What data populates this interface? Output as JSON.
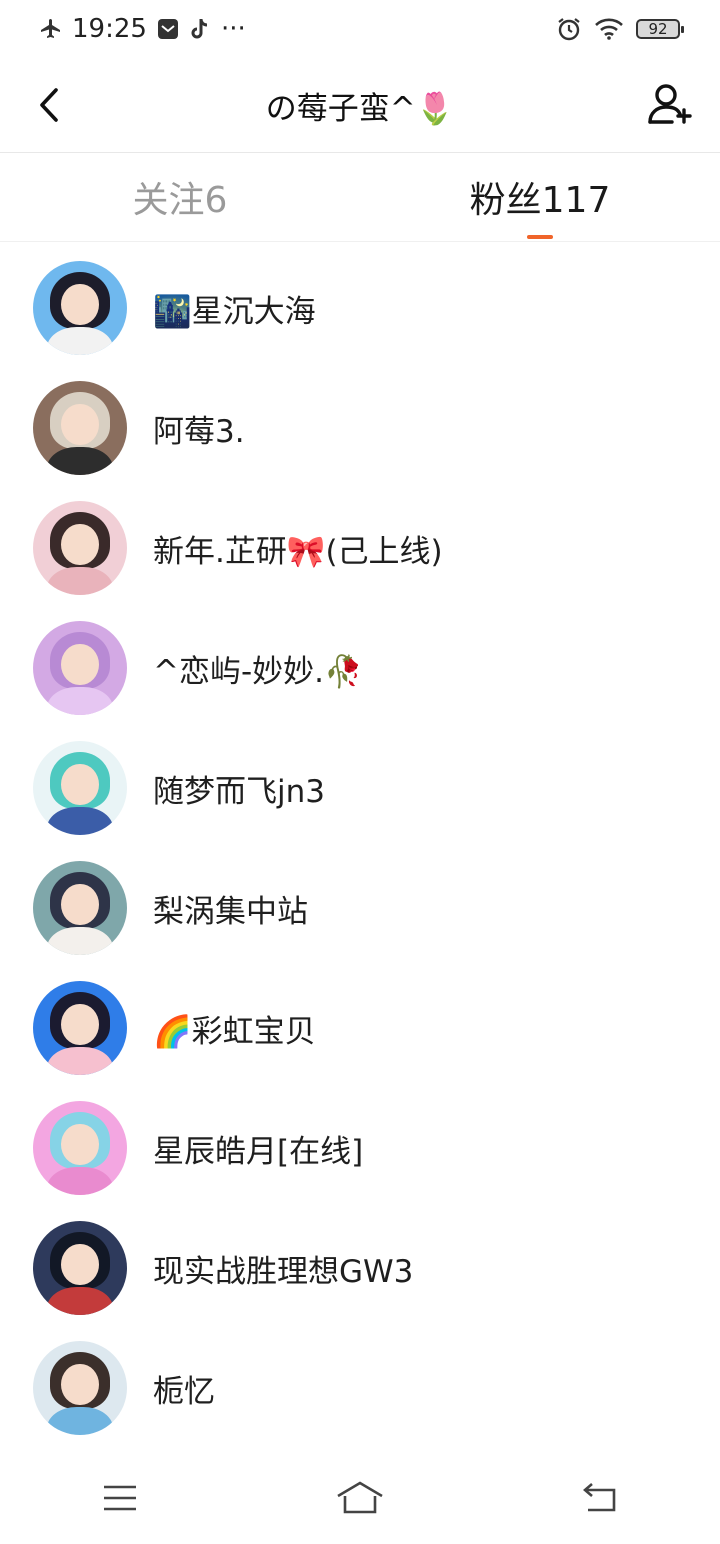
{
  "status_bar": {
    "time": "19:25",
    "more": "···",
    "battery": "92",
    "icons": [
      "airplane-icon",
      "mail-icon",
      "tiktok-icon",
      "alarm-icon",
      "wifi-icon",
      "battery-icon"
    ]
  },
  "header": {
    "title": "の莓子蛮^🌷"
  },
  "tabs": [
    {
      "label": "关注6",
      "active": false
    },
    {
      "label": "粉丝117",
      "active": true
    }
  ],
  "colors": {
    "accent": "#f0642a",
    "inactive_tab": "#9a9a9a"
  },
  "followers": [
    {
      "name": "🌃星沉大海",
      "avatar_bg": "#6fb8ee",
      "hair": "#1d1d2b",
      "body": "#f2f2f2"
    },
    {
      "name": "阿莓3.",
      "avatar_bg": "#8a6e5e",
      "hair": "#d8cfc2",
      "body": "#2d2d2d"
    },
    {
      "name": "新年.芷研🎀(己上线)",
      "avatar_bg": "#f1cfd6",
      "hair": "#3a2a2a",
      "body": "#e9b3bb"
    },
    {
      "name": "^恋屿-妙妙.🥀",
      "avatar_bg": "#d3a9e4",
      "hair": "#b88ad4",
      "body": "#e6c6f2"
    },
    {
      "name": "随梦而飞jn3",
      "avatar_bg": "#e9f4f6",
      "hair": "#4ec9c0",
      "body": "#3b5da8"
    },
    {
      "name": "梨涡集中站",
      "avatar_bg": "#7fa7aa",
      "hair": "#2e3448",
      "body": "#f3f0ec"
    },
    {
      "name": "🌈彩虹宝贝",
      "avatar_bg": "#2f7de8",
      "hair": "#1b1b30",
      "body": "#f6c0cf"
    },
    {
      "name": "星辰皓月[在线]",
      "avatar_bg": "#f3a6e1",
      "hair": "#86d3e6",
      "body": "#e98bcf"
    },
    {
      "name": "现实战胜理想GW3",
      "avatar_bg": "#2e3a5c",
      "hair": "#121826",
      "body": "#c33b3b"
    },
    {
      "name": "栀忆",
      "avatar_bg": "#dde8ef",
      "hair": "#3b2f2b",
      "body": "#6fb4e0"
    }
  ]
}
